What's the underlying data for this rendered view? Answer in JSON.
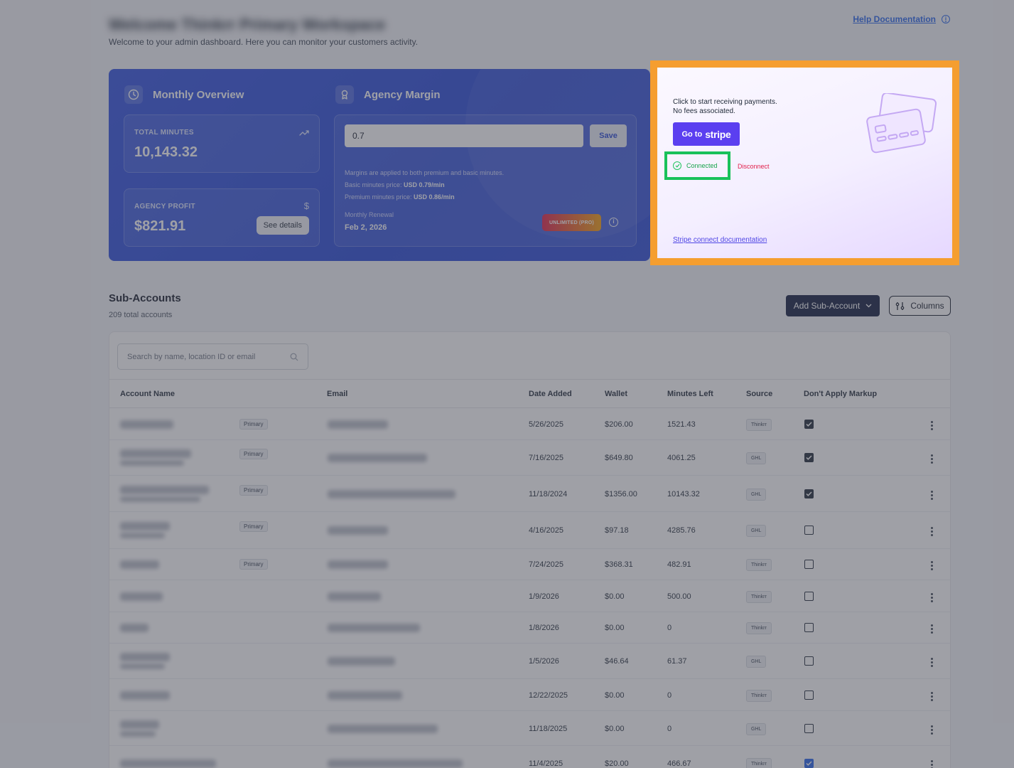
{
  "header": {
    "title": "Welcome Thinkrr Primary Workspace",
    "subtitle": "Welcome to your admin dashboard. Here you can monitor your customers activity.",
    "help_link": "Help Documentation"
  },
  "overview": {
    "monthly_title": "Monthly Overview",
    "total_minutes_label": "TOTAL MINUTES",
    "total_minutes_value": "10,143.32",
    "agency_profit_label": "AGENCY PROFIT",
    "agency_profit_value": "$821.91",
    "see_details": "See details",
    "profit_icon": "$"
  },
  "margin": {
    "title": "Agency Margin",
    "input_value": "0.7",
    "save": "Save",
    "note_line1": "Margins are applied to both premium and basic minutes.",
    "note_basic_label": "Basic minutes price:",
    "note_basic_value": "USD 0.79/min",
    "note_premium_label": "Premium minutes price:",
    "note_premium_value": "USD 0.86/min",
    "renewal_label": "Monthly Renewal",
    "renewal_date": "Feb 2, 2026",
    "plan_badge": "UNLIMITED (PRO)"
  },
  "stripe": {
    "line1": "Click to start receiving payments.",
    "line2": "No fees associated.",
    "button_prefix": "Go to",
    "button_brand": "stripe",
    "connected": "Connected",
    "disconnect": "Disconnect",
    "doc_link": "Stripe connect documentation",
    "accent_frame": "#f59e2f",
    "connected_frame": "#19c15a"
  },
  "sub_accounts": {
    "title": "Sub-Accounts",
    "count": "209 total accounts",
    "add_button": "Add Sub-Account",
    "columns_button": "Columns",
    "search_placeholder": "Search by name, location ID or email",
    "columns": [
      "Account Name",
      "Email",
      "Date Added",
      "Wallet",
      "Minutes Left",
      "Source",
      "Don't Apply Markup"
    ],
    "rows": [
      {
        "primary": "Primary",
        "date": "5/26/2025",
        "wallet": "$206.00",
        "minutes": "1521.43",
        "source": "Thinkrr",
        "markup": true
      },
      {
        "primary": "Primary",
        "date": "7/16/2025",
        "wallet": "$649.80",
        "minutes": "4061.25",
        "source": "GHL",
        "markup": true
      },
      {
        "primary": "Primary",
        "date": "11/18/2024",
        "wallet": "$1356.00",
        "minutes": "10143.32",
        "source": "GHL",
        "markup": true
      },
      {
        "primary": "Primary",
        "date": "4/16/2025",
        "wallet": "$97.18",
        "minutes": "4285.76",
        "source": "GHL",
        "markup": false
      },
      {
        "primary": "Primary",
        "date": "7/24/2025",
        "wallet": "$368.31",
        "minutes": "482.91",
        "source": "Thinkrr",
        "markup": false
      },
      {
        "primary": "",
        "date": "1/9/2026",
        "wallet": "$0.00",
        "minutes": "500.00",
        "source": "Thinkrr",
        "markup": false
      },
      {
        "primary": "",
        "date": "1/8/2026",
        "wallet": "$0.00",
        "minutes": "0",
        "source": "Thinkrr",
        "markup": false
      },
      {
        "primary": "",
        "date": "1/5/2026",
        "wallet": "$46.64",
        "minutes": "61.37",
        "source": "GHL",
        "markup": false
      },
      {
        "primary": "",
        "date": "12/22/2025",
        "wallet": "$0.00",
        "minutes": "0",
        "source": "Thinkrr",
        "markup": false
      },
      {
        "primary": "",
        "date": "11/18/2025",
        "wallet": "$0.00",
        "minutes": "0",
        "source": "GHL",
        "markup": false
      },
      {
        "primary": "",
        "date": "11/4/2025",
        "wallet": "$20.00",
        "minutes": "466.67",
        "source": "Thinkrr",
        "markup": true
      }
    ]
  }
}
